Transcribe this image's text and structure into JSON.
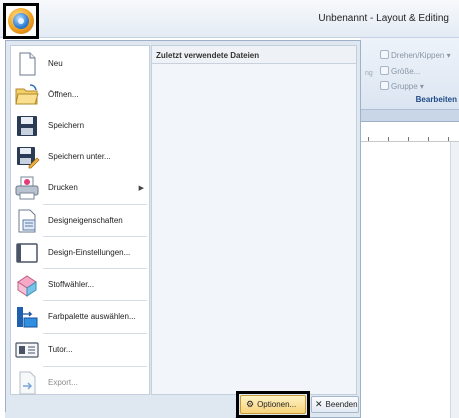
{
  "window": {
    "title": "Unbenannt - Layout & Editing"
  },
  "ribbon": {
    "items": [
      "Drehen/Kippen",
      "Größe...",
      "Gruppe"
    ],
    "fragment": "ng",
    "group_label": "Bearbeiten"
  },
  "menu": {
    "recent_header": "Zuletzt verwendete Dateien",
    "items": [
      {
        "label": "Neu",
        "icon": "new-document-icon",
        "enabled": true
      },
      {
        "label": "Öffnen...",
        "icon": "open-folder-icon",
        "enabled": true
      },
      {
        "label": "Speichern",
        "icon": "save-disk-icon",
        "enabled": true
      },
      {
        "label": "Speichern unter...",
        "icon": "save-as-icon",
        "enabled": true
      },
      {
        "label": "Drucken",
        "icon": "printer-icon",
        "enabled": true,
        "submenu": true
      },
      {
        "label": "Designeigenschaften",
        "icon": "design-properties-icon",
        "enabled": true
      },
      {
        "label": "Design-Einstellungen...",
        "icon": "design-settings-icon",
        "enabled": true
      },
      {
        "label": "Stoffwähler...",
        "icon": "fabric-selector-icon",
        "enabled": true
      },
      {
        "label": "Farbpalette auswählen...",
        "icon": "color-palette-icon",
        "enabled": true
      },
      {
        "label": "Tutor...",
        "icon": "tutor-icon",
        "enabled": true
      },
      {
        "label": "Export...",
        "icon": "export-icon",
        "enabled": false
      }
    ],
    "options_label": "Optionen...",
    "exit_label": "Beenden"
  },
  "colors": {
    "accent": "#f6d27b",
    "menu_bg": "#dfe7f1",
    "group_label": "#1f4a86"
  }
}
